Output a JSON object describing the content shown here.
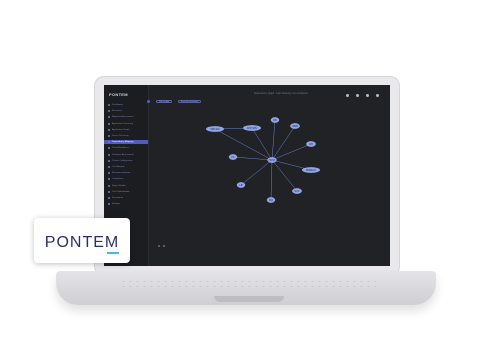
{
  "branding": {
    "logo_text": "PONTEM",
    "accent": "#4db6e6"
  },
  "app": {
    "logo": "PONTEM",
    "sidebar_items": [
      {
        "label": "Dashboard",
        "style": "normal"
      },
      {
        "label": "Resources",
        "style": "normal"
      },
      {
        "label": "Migration Assessment",
        "style": "normal"
      },
      {
        "label": "Application Discovery",
        "style": "normal"
      },
      {
        "label": "Application Graph",
        "style": "normal"
      },
      {
        "label": "Server Discovery",
        "style": "normal"
      },
      {
        "label": "Dependency Mapping",
        "style": "active"
      },
      {
        "label": "Cloud Readiness",
        "style": "normal"
      },
      {
        "label": "Database Assessment",
        "style": "normal"
      },
      {
        "label": "Cluster Configuration",
        "style": "normal"
      },
      {
        "label": "Cost Analysis",
        "style": "normal"
      },
      {
        "label": "Recommendations",
        "style": "normal"
      },
      {
        "label": "Compliance",
        "style": "normal"
      },
      {
        "label": "Report Builder",
        "style": "normal"
      },
      {
        "label": "Cost Optimization",
        "style": "orange"
      },
      {
        "label": "Documents",
        "style": "normal"
      },
      {
        "label": "Settings",
        "style": "normal"
      }
    ],
    "topbar_status": "Dependency graph · Last discovery run completed",
    "filter_pills": [
      "Filter by App",
      "Show all connections"
    ],
    "colors": {
      "sidebar_active": "#4d5ec0",
      "node_fill": "#8ea5ea",
      "edge": "#6d82c8",
      "screen_bg": "#212226"
    },
    "graph": {
      "center": {
        "label": "HOST"
      },
      "nodes": [
        {
          "label": "SRV-001"
        },
        {
          "label": "APP-SRV"
        },
        {
          "label": "DB"
        },
        {
          "label": "WEB"
        },
        {
          "label": "API"
        },
        {
          "label": "NODE-07"
        },
        {
          "label": "SVC"
        },
        {
          "label": "MQ"
        },
        {
          "label": "LB"
        },
        {
          "label": "FS"
        },
        {
          "label": "CACHE"
        }
      ]
    }
  }
}
